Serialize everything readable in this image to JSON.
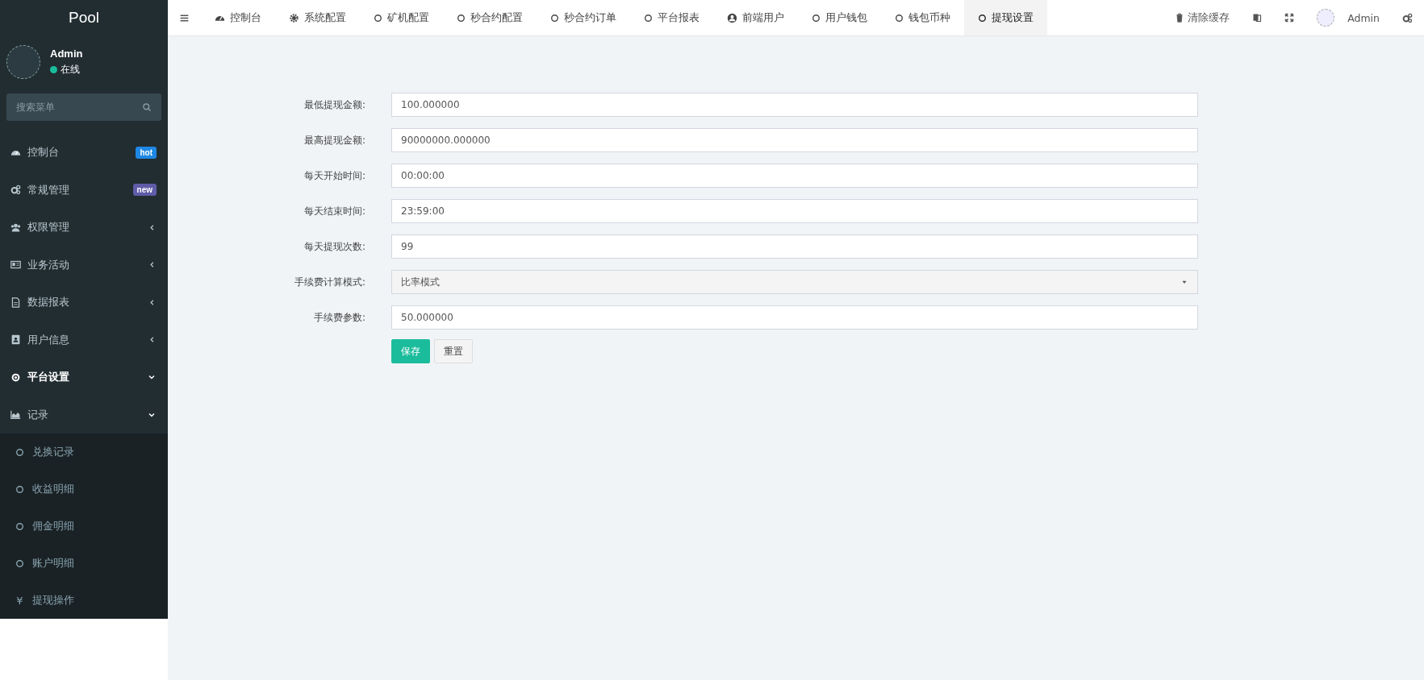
{
  "sidebar": {
    "logo": "Pool",
    "user": {
      "name": "Admin",
      "status": "在线"
    },
    "search": {
      "placeholder": "搜索菜单"
    },
    "items": [
      {
        "label": "控制台",
        "badge": "hot",
        "color": "#1e88e5",
        "selected": false
      },
      {
        "label": "常规管理",
        "badge": "new",
        "color": "#605ca8",
        "selected": false
      },
      {
        "label": "权限管理",
        "expanded": false,
        "selected": false
      },
      {
        "label": "业务活动",
        "expanded": false,
        "selected": false
      },
      {
        "label": "数据报表",
        "expanded": false,
        "selected": false
      },
      {
        "label": "用户信息",
        "expanded": false,
        "selected": false
      },
      {
        "label": "平台设置",
        "expanded": true,
        "selected": true
      },
      {
        "label": "记录",
        "expanded": true,
        "selected": false,
        "children": [
          {
            "label": "兑换记录"
          },
          {
            "label": "收益明细"
          },
          {
            "label": "佣金明细"
          },
          {
            "label": "账户明细"
          },
          {
            "label": "提现操作",
            "symbol": "¥"
          }
        ]
      }
    ]
  },
  "tabs": [
    {
      "label": "控制台",
      "selected": false
    },
    {
      "label": "系统配置",
      "selected": false
    },
    {
      "label": "矿机配置",
      "selected": false
    },
    {
      "label": "秒合约配置",
      "selected": false
    },
    {
      "label": "秒合约订单",
      "selected": false
    },
    {
      "label": "平台报表",
      "selected": false
    },
    {
      "label": "前端用户",
      "selected": false
    },
    {
      "label": "用户钱包",
      "selected": false
    },
    {
      "label": "钱包币种",
      "selected": false
    },
    {
      "label": "提现设置",
      "selected": true
    }
  ],
  "toolbar": {
    "clear_cache": "清除缓存",
    "user": "Admin"
  },
  "form": {
    "fields": [
      {
        "label": "最低提现金额:",
        "value": "100.000000",
        "kind": "input"
      },
      {
        "label": "最高提现金额:",
        "value": "90000000.000000",
        "kind": "input"
      },
      {
        "label": "每天开始时间:",
        "value": "00:00:00",
        "kind": "input"
      },
      {
        "label": "每天结束时间:",
        "value": "23:59:00",
        "kind": "input"
      },
      {
        "label": "每天提现次数:",
        "value": "99",
        "kind": "input"
      },
      {
        "label": "手续费计算模式:",
        "value": "比率模式",
        "kind": "select"
      },
      {
        "label": "手续费参数:",
        "value": "50.000000",
        "kind": "input"
      }
    ],
    "buttons": [
      "保存",
      "重置"
    ]
  }
}
